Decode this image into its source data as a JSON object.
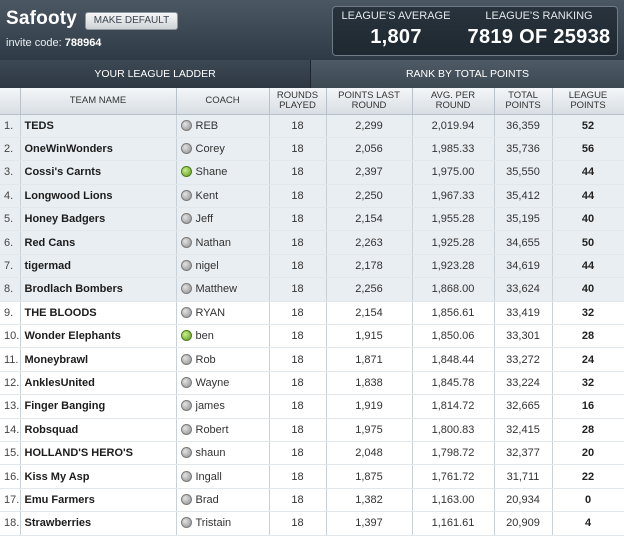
{
  "header": {
    "league_name": "Safooty",
    "make_default_label": "MAKE DEFAULT",
    "invite_label": "invite code:",
    "invite_code": "788964",
    "avg_label": "LEAGUE'S AVERAGE",
    "avg_value": "1,807",
    "rank_label": "LEAGUE'S RANKING",
    "rank_value": "7819 OF 25938"
  },
  "tabs": [
    {
      "label": "YOUR LEAGUE LADDER"
    },
    {
      "label": "RANK BY TOTAL POINTS"
    }
  ],
  "table": {
    "columns": [
      "TEAM NAME",
      "COACH",
      "ROUNDS PLAYED",
      "POINTS LAST ROUND",
      "AVG. PER ROUND",
      "TOTAL POINTS",
      "LEAGUE POINTS"
    ],
    "rows": [
      {
        "pos": "1.",
        "team": "TEDS",
        "coach": "REB",
        "status": "grey",
        "rounds": "18",
        "last": "2,299",
        "avg": "2,019.94",
        "total": "36,359",
        "league": "52"
      },
      {
        "pos": "2.",
        "team": "OneWinWonders",
        "coach": "Corey",
        "status": "grey",
        "rounds": "18",
        "last": "2,056",
        "avg": "1,985.33",
        "total": "35,736",
        "league": "56"
      },
      {
        "pos": "3.",
        "team": "Cossi's Carnts",
        "coach": "Shane",
        "status": "green",
        "rounds": "18",
        "last": "2,397",
        "avg": "1,975.00",
        "total": "35,550",
        "league": "44"
      },
      {
        "pos": "4.",
        "team": "Longwood Lions",
        "coach": "Kent",
        "status": "grey",
        "rounds": "18",
        "last": "2,250",
        "avg": "1,967.33",
        "total": "35,412",
        "league": "44"
      },
      {
        "pos": "5.",
        "team": "Honey Badgers",
        "coach": "Jeff",
        "status": "grey",
        "rounds": "18",
        "last": "2,154",
        "avg": "1,955.28",
        "total": "35,195",
        "league": "40"
      },
      {
        "pos": "6.",
        "team": "Red Cans",
        "coach": "Nathan",
        "status": "grey",
        "rounds": "18",
        "last": "2,263",
        "avg": "1,925.28",
        "total": "34,655",
        "league": "50"
      },
      {
        "pos": "7.",
        "team": "tigermad",
        "coach": "nigel",
        "status": "grey",
        "rounds": "18",
        "last": "2,178",
        "avg": "1,923.28",
        "total": "34,619",
        "league": "44"
      },
      {
        "pos": "8.",
        "team": "Brodlach Bombers",
        "coach": "Matthew",
        "status": "grey",
        "rounds": "18",
        "last": "2,256",
        "avg": "1,868.00",
        "total": "33,624",
        "league": "40"
      },
      {
        "pos": "9.",
        "team": "THE BLOODS",
        "coach": "RYAN",
        "status": "grey",
        "rounds": "18",
        "last": "2,154",
        "avg": "1,856.61",
        "total": "33,419",
        "league": "32"
      },
      {
        "pos": "10.",
        "team": "Wonder Elephants",
        "coach": "ben",
        "status": "green",
        "rounds": "18",
        "last": "1,915",
        "avg": "1,850.06",
        "total": "33,301",
        "league": "28"
      },
      {
        "pos": "11.",
        "team": "Moneybrawl",
        "coach": "Rob",
        "status": "grey",
        "rounds": "18",
        "last": "1,871",
        "avg": "1,848.44",
        "total": "33,272",
        "league": "24"
      },
      {
        "pos": "12.",
        "team": "AnklesUnited",
        "coach": "Wayne",
        "status": "grey",
        "rounds": "18",
        "last": "1,838",
        "avg": "1,845.78",
        "total": "33,224",
        "league": "32"
      },
      {
        "pos": "13.",
        "team": "Finger Banging",
        "coach": "james",
        "status": "grey",
        "rounds": "18",
        "last": "1,919",
        "avg": "1,814.72",
        "total": "32,665",
        "league": "16"
      },
      {
        "pos": "14.",
        "team": "Robsquad",
        "coach": "Robert",
        "status": "grey",
        "rounds": "18",
        "last": "1,975",
        "avg": "1,800.83",
        "total": "32,415",
        "league": "28"
      },
      {
        "pos": "15.",
        "team": "HOLLAND'S HERO'S",
        "coach": "shaun",
        "status": "grey",
        "rounds": "18",
        "last": "2,048",
        "avg": "1,798.72",
        "total": "32,377",
        "league": "20"
      },
      {
        "pos": "16.",
        "team": "Kiss My Asp",
        "coach": "Ingall",
        "status": "grey",
        "rounds": "18",
        "last": "1,875",
        "avg": "1,761.72",
        "total": "31,711",
        "league": "22"
      },
      {
        "pos": "17.",
        "team": "Emu Farmers",
        "coach": "Brad",
        "status": "grey",
        "rounds": "18",
        "last": "1,382",
        "avg": "1,163.00",
        "total": "20,934",
        "league": "0"
      },
      {
        "pos": "18.",
        "team": "Strawberries",
        "coach": "Tristain",
        "status": "grey",
        "rounds": "18",
        "last": "1,397",
        "avg": "1,161.61",
        "total": "20,909",
        "league": "4"
      }
    ]
  }
}
